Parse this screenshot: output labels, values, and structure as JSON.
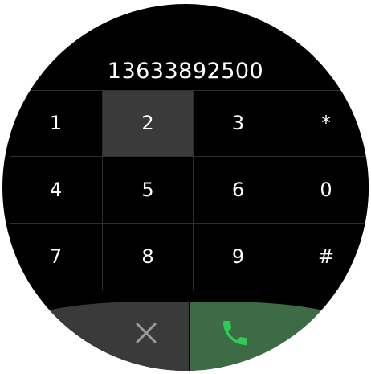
{
  "display": {
    "number": "13633892500"
  },
  "keypad": {
    "keys": [
      "1",
      "2",
      "3",
      "*",
      "4",
      "5",
      "6",
      "0",
      "7",
      "8",
      "9",
      "#"
    ],
    "pressed_key": "2"
  },
  "actions": {
    "clear_icon": "close-icon",
    "call_icon": "phone-icon"
  },
  "colors": {
    "background": "#000000",
    "key_pressed": "#3a3a3a",
    "clear_button": "#3a3a3a",
    "call_button": "#3d6b44",
    "call_icon": "#2ecc55",
    "clear_icon": "#9a9a9a"
  }
}
